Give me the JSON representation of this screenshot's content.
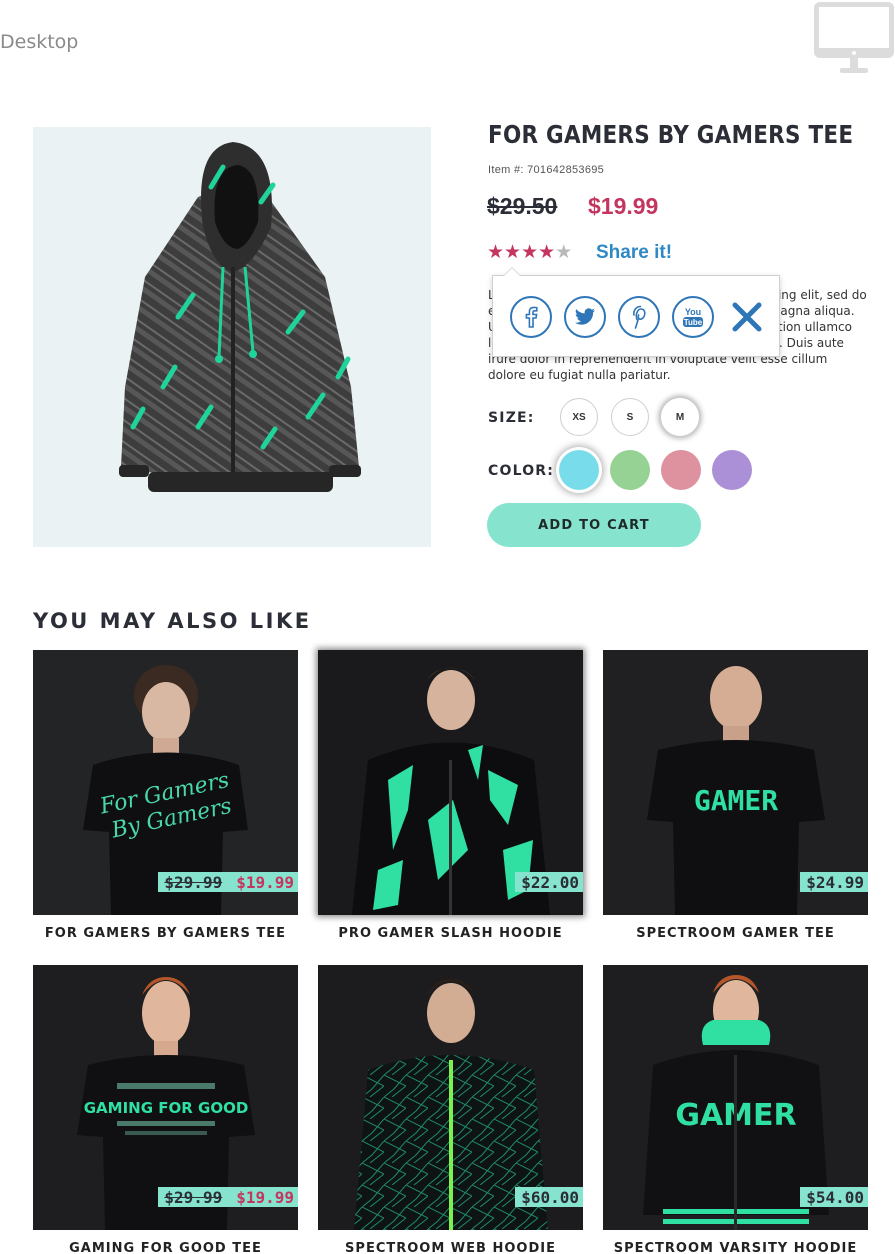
{
  "viewport": {
    "label": "Desktop",
    "icon": "desktop-monitor-icon"
  },
  "product": {
    "title": "FOR GAMERS BY GAMERS TEE",
    "sku": "Item #: 701642853695",
    "old_price": "$29.50",
    "price": "$19.99",
    "rating": {
      "value": 4,
      "max": 5
    },
    "share_label": "Share it!",
    "description": "Lorem ipsum dolor sit amet, consectetur adipiscing elit, sed do eiusmod tempor incididunt ut labore et dolore magna aliqua. Ut enim ad minim veniam, quis nostrud exercitation ullamco laboris nisi ut aliquip ex ea commodo consequat. Duis aute irure dolor in reprehenderit in voluptate velit esse cillum dolore eu fugiat nulla pariatur.",
    "size_label": "SIZE:",
    "sizes": [
      {
        "label": "XS",
        "selected": false
      },
      {
        "label": "S",
        "selected": false
      },
      {
        "label": "M",
        "selected": true
      }
    ],
    "color_label": "COLOR:",
    "colors": [
      {
        "hex": "#79dcea",
        "selected": true
      },
      {
        "hex": "#96d294",
        "selected": false
      },
      {
        "hex": "#de929f",
        "selected": false
      },
      {
        "hex": "#ac90d7",
        "selected": false
      }
    ],
    "add_to_cart": "ADD TO CART",
    "accent_color": "#86e3ce",
    "sale_color": "#c4365f"
  },
  "share_popup": {
    "buttons": [
      {
        "name": "facebook-icon"
      },
      {
        "name": "twitter-icon"
      },
      {
        "name": "pinterest-icon"
      },
      {
        "name": "youtube-icon",
        "text_top": "You",
        "text_bottom": "Tube"
      }
    ],
    "close": "close-icon"
  },
  "related": {
    "title": "YOU MAY ALSO LIKE",
    "items": [
      {
        "name": "FOR GAMERS BY GAMERS TEE",
        "old_price": "$29.99",
        "price": "$19.99",
        "graphic_lines": [
          "For Gamers",
          "By Gamers"
        ]
      },
      {
        "name": "PRO GAMER SLASH HOODIE",
        "price": "$22.00"
      },
      {
        "name": "SPECTROOM GAMER TEE",
        "price": "$24.99",
        "graphic_text": "GAMER"
      },
      {
        "name": "GAMING FOR GOOD TEE",
        "old_price": "$29.99",
        "price": "$19.99",
        "graphic_text": "GAMING FOR GOOD"
      },
      {
        "name": "SPECTROOM WEB HOODIE",
        "price": "$60.00"
      },
      {
        "name": "SPECTROOM VARSITY HOODIE",
        "price": "$54.00",
        "graphic_text": "GAMER"
      }
    ]
  }
}
